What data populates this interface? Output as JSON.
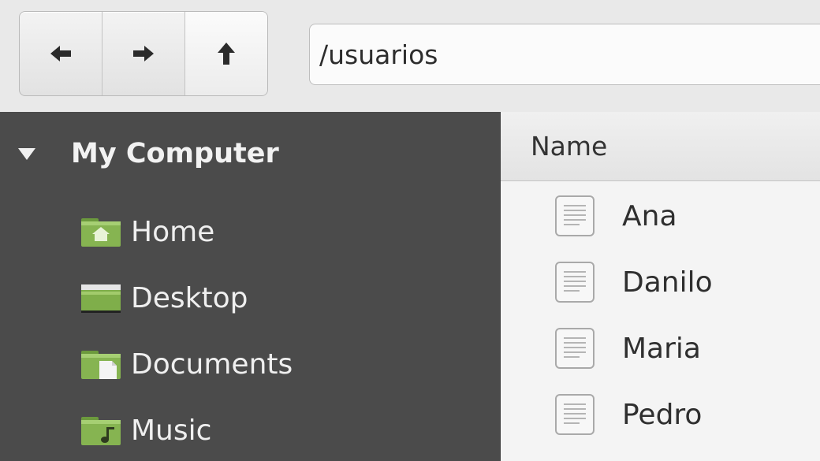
{
  "toolbar": {
    "back_icon": "arrow-left-icon",
    "forward_icon": "arrow-right-icon",
    "up_icon": "arrow-up-icon",
    "path_value": "/usuarios"
  },
  "sidebar": {
    "heading": "My Computer",
    "items": [
      {
        "label": "Home",
        "icon": "home-folder-icon"
      },
      {
        "label": "Desktop",
        "icon": "desktop-icon"
      },
      {
        "label": "Documents",
        "icon": "documents-folder-icon"
      },
      {
        "label": "Music",
        "icon": "music-folder-icon"
      }
    ]
  },
  "filelist": {
    "column_name": "Name",
    "files": [
      {
        "name": "Ana",
        "icon": "text-file-icon"
      },
      {
        "name": "Danilo",
        "icon": "text-file-icon"
      },
      {
        "name": "Maria",
        "icon": "text-file-icon"
      },
      {
        "name": "Pedro",
        "icon": "text-file-icon"
      }
    ]
  },
  "colors": {
    "sidebar_bg": "#4b4b4b",
    "folder_green": "#7fae4a",
    "toolbar_bg": "#e9e9e9",
    "list_bg": "#f4f4f4"
  }
}
